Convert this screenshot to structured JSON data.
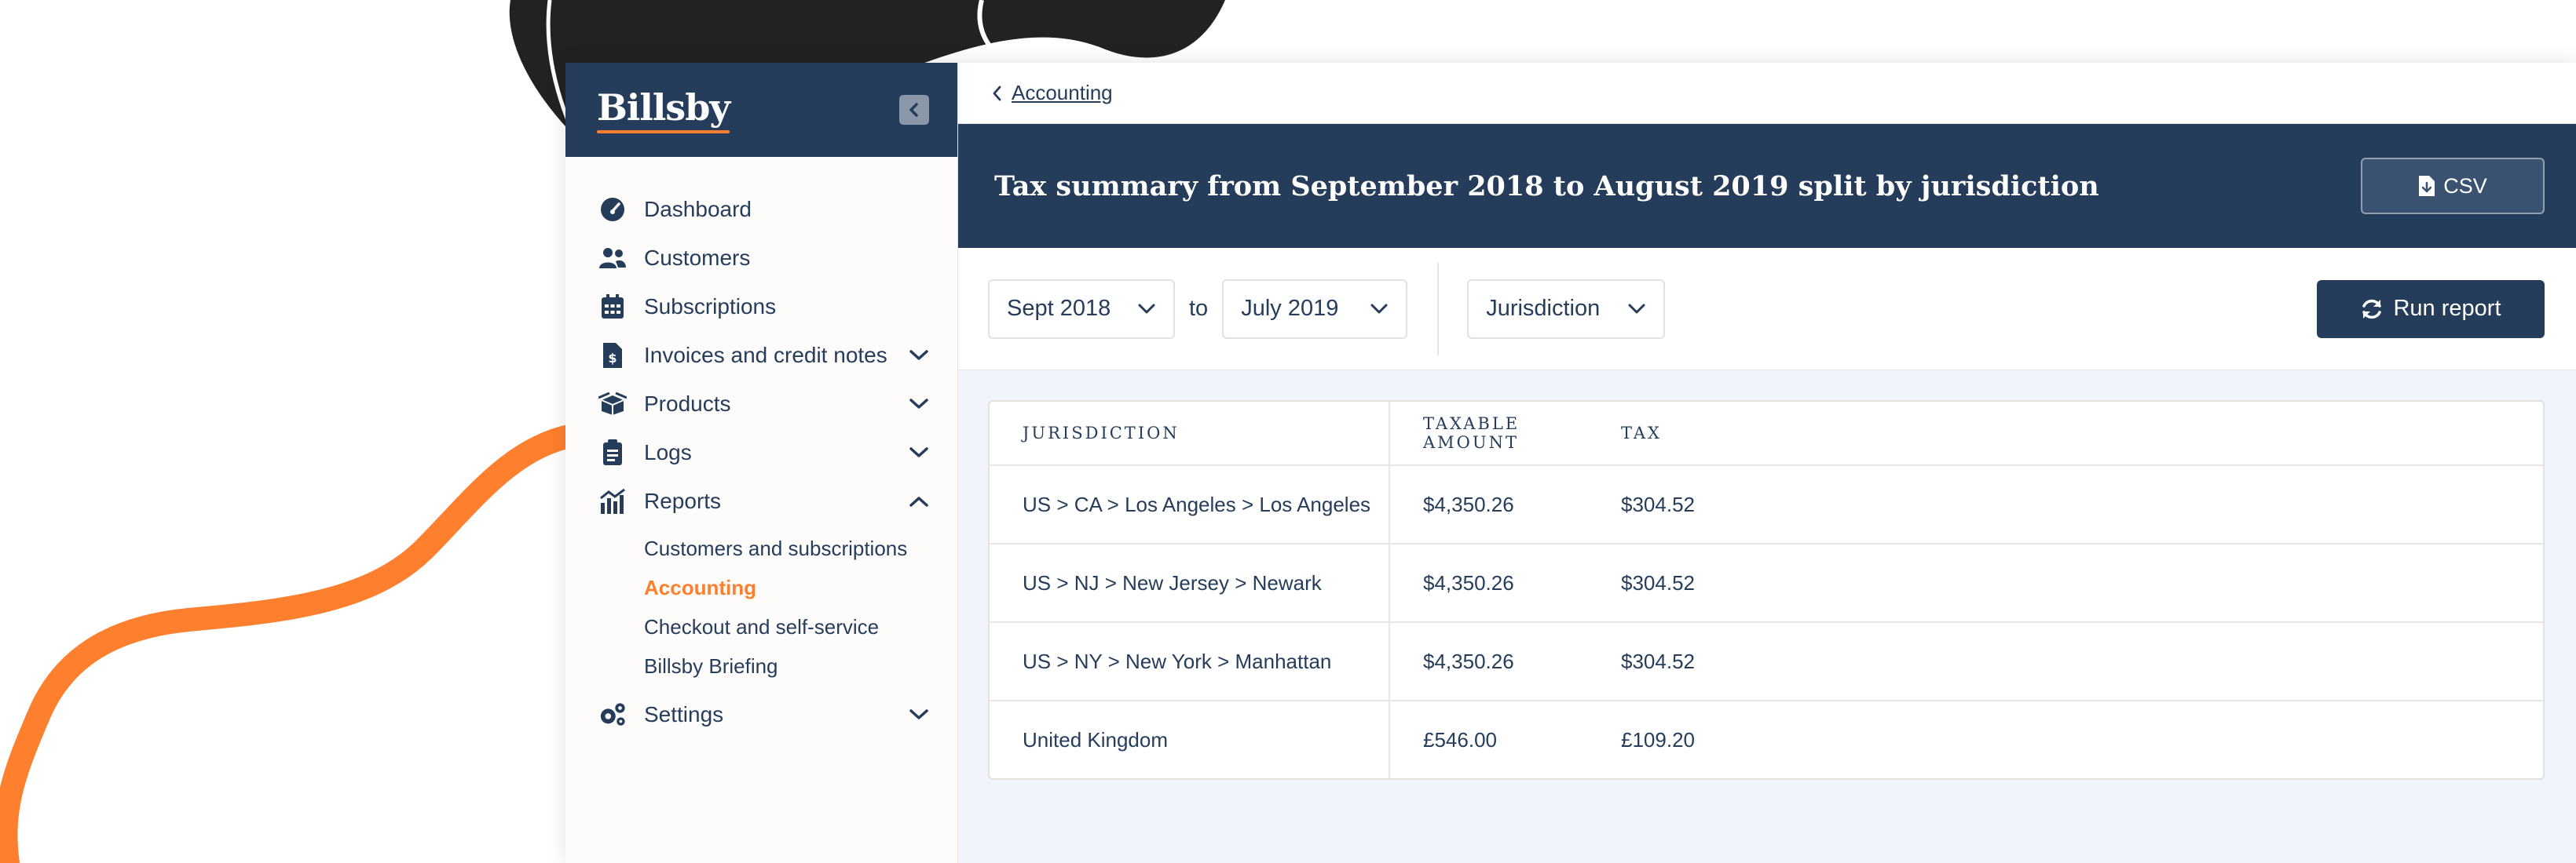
{
  "app": {
    "logo": "Billsby"
  },
  "sidebar": {
    "items": [
      {
        "label": "Dashboard",
        "icon": "gauge-icon",
        "expandable": false
      },
      {
        "label": "Customers",
        "icon": "users-icon",
        "expandable": false
      },
      {
        "label": "Subscriptions",
        "icon": "calendar-icon",
        "expandable": false
      },
      {
        "label": "Invoices and credit notes",
        "icon": "invoice-icon",
        "expandable": true,
        "expanded": false
      },
      {
        "label": "Products",
        "icon": "box-icon",
        "expandable": true,
        "expanded": false
      },
      {
        "label": "Logs",
        "icon": "clipboard-icon",
        "expandable": true,
        "expanded": false
      },
      {
        "label": "Reports",
        "icon": "chart-icon",
        "expandable": true,
        "expanded": true
      },
      {
        "label": "Settings",
        "icon": "gears-icon",
        "expandable": true,
        "expanded": false
      }
    ],
    "reports_subitems": [
      {
        "label": "Customers and subscriptions",
        "active": false
      },
      {
        "label": "Accounting",
        "active": true
      },
      {
        "label": "Checkout and self-service",
        "active": false
      },
      {
        "label": "Billsby Briefing",
        "active": false
      }
    ]
  },
  "breadcrumb": {
    "label": "Accounting"
  },
  "header": {
    "title": "Tax summary from September 2018 to August 2019 split by jurisdiction",
    "csv_label": "CSV"
  },
  "filters": {
    "from_value": "Sept 2018",
    "to_label": "to",
    "to_value": "July 2019",
    "group_value": "Jurisdiction",
    "run_label": "Run report"
  },
  "table": {
    "columns": [
      "JURISDICTION",
      "TAXABLE AMOUNT",
      "TAX"
    ],
    "rows": [
      [
        "US > CA > Los Angeles > Los Angeles",
        "$4,350.26",
        "$304.52"
      ],
      [
        "US > NJ > New Jersey > Newark",
        "$4,350.26",
        "$304.52"
      ],
      [
        "US > NY > New York > Manhattan",
        "$4,350.26",
        "$304.52"
      ],
      [
        "United Kingdom",
        "£546.00",
        "£109.20"
      ]
    ]
  },
  "colors": {
    "navy": "#253d5b",
    "accent_orange": "#fe7f2d",
    "background": "#f1f4fb"
  }
}
